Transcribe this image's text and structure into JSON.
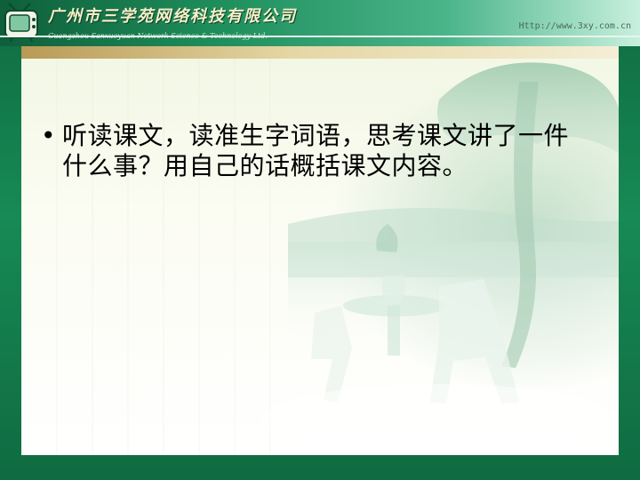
{
  "header": {
    "company_name_cn": "广州市三学苑网络科技有限公司",
    "company_name_en": "Guangzhou Sanxueyuan Network Science & Technology Ltd.",
    "url": "Http://www.3xy.com.cn",
    "logo_icon": "tv-logo-icon"
  },
  "slide": {
    "bullet_symbol": "•",
    "bullet_text": "听读课文，读准生字词语，思考课文讲了一件什么事？用自己的话概括课文内容。"
  },
  "colors": {
    "frame_green": "#157a4b",
    "title_text": "#f8f0c8",
    "body_text": "#000000"
  }
}
